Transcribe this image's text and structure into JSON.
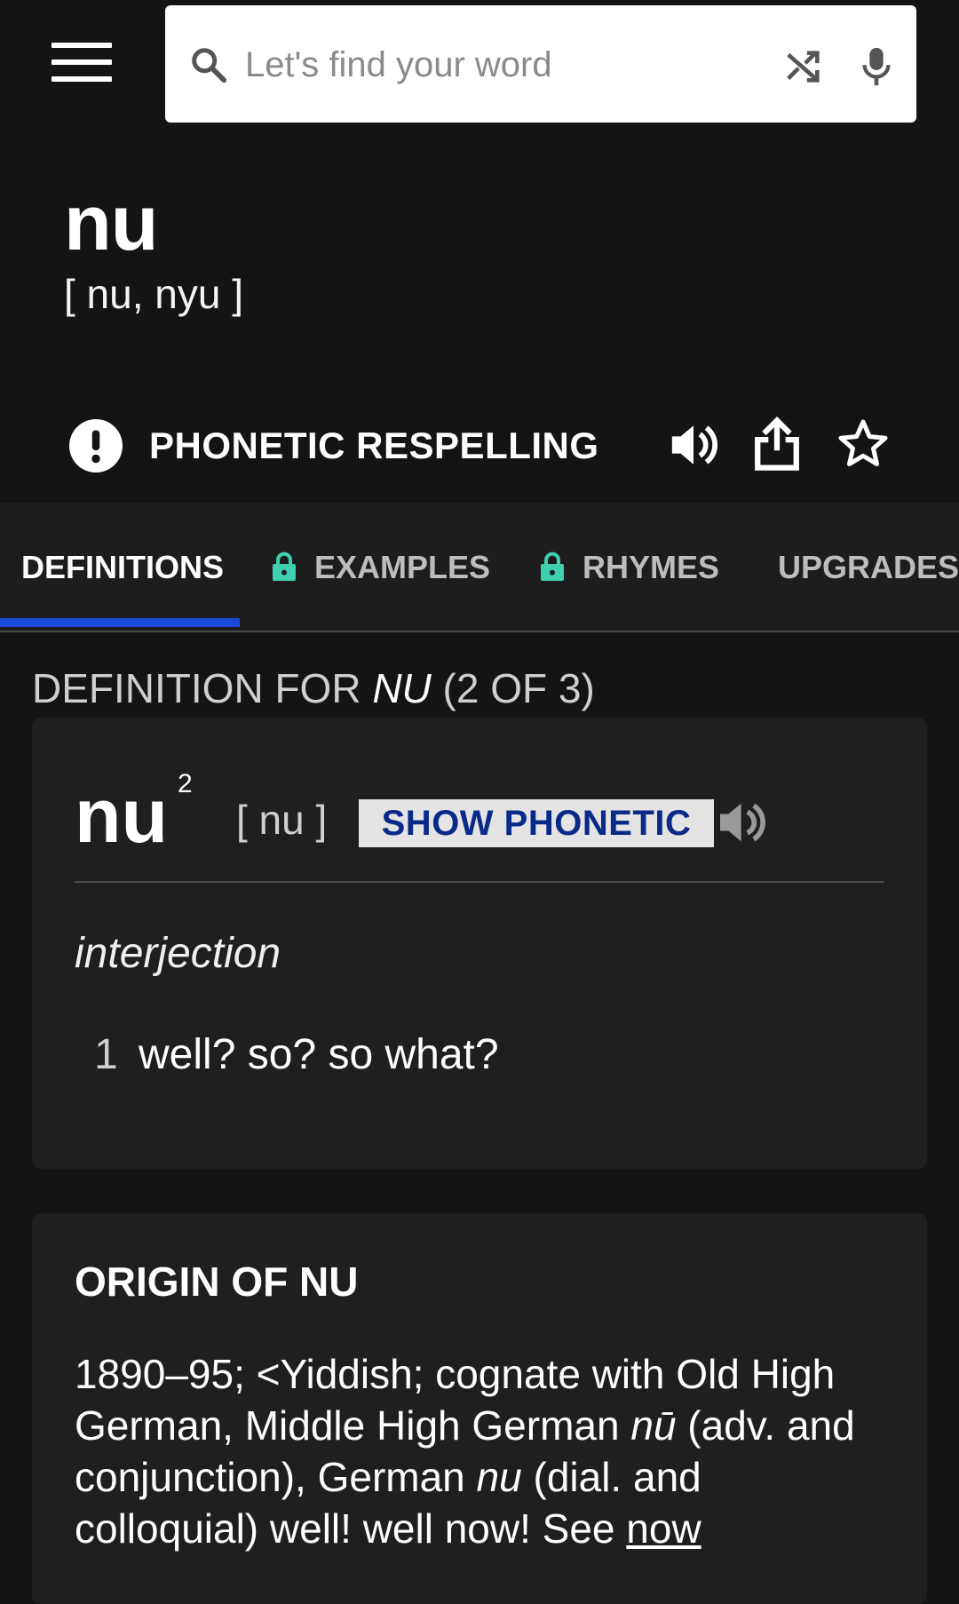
{
  "search": {
    "placeholder": "Let's find your word"
  },
  "entry": {
    "word": "nu",
    "pronunciation": "[ nu, nyu  ]"
  },
  "phonetic_bar": {
    "label": "PHONETIC RESPELLING"
  },
  "tabs": [
    {
      "label": "DEFINITIONS"
    },
    {
      "label": "EXAMPLES"
    },
    {
      "label": "RHYMES"
    },
    {
      "label": "UPGRADES"
    }
  ],
  "definition_heading": {
    "prefix": "DEFINITION FOR ",
    "word": "NU",
    "suffix": " (2 OF 3)"
  },
  "definition_card": {
    "headword": "nu",
    "superscript": "2",
    "pronunciation": "[ nu ]",
    "show_phonetic_label": "SHOW PHONETIC",
    "part_of_speech": "interjection",
    "sense_number": "1",
    "sense_text": "well? so? so what?"
  },
  "origin_card": {
    "title": "ORIGIN OF NU",
    "text_1": "1890–95; <Yiddish; cognate with Old High German, Middle High German ",
    "italic_1": "nū",
    "text_2": " (adv. and conjunction), German ",
    "italic_2": "nu",
    "text_3": " (dial. and colloquial) well! well now! See ",
    "link": "now"
  },
  "colors": {
    "background": "#141414",
    "card": "#1f1f1f",
    "accent": "#1a4bd6",
    "lock": "#3fd0b0",
    "phonetic_button_text": "#0a2a8a"
  }
}
